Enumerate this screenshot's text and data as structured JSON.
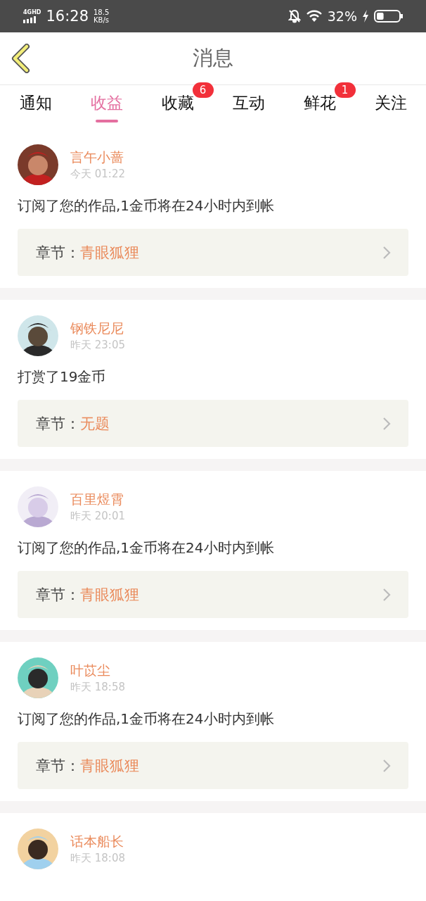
{
  "status_bar": {
    "network": "4GHD",
    "time": "16:28",
    "speed": "18.5",
    "speed_unit": "KB/s",
    "battery": "32%"
  },
  "header": {
    "title": "消息"
  },
  "tabs": [
    {
      "label": "通知",
      "selected": false
    },
    {
      "label": "收益",
      "selected": true
    },
    {
      "label": "收藏",
      "selected": false,
      "badge": "6"
    },
    {
      "label": "互动",
      "selected": false
    },
    {
      "label": "鲜花",
      "selected": false,
      "badge": "1"
    },
    {
      "label": "关注",
      "selected": false
    }
  ],
  "messages": [
    {
      "user": "言午小蔷",
      "time": "今天 01:22",
      "text": "订阅了您的作品,1金币将在24小时内到帐",
      "chapter_label": "章节：",
      "chapter": "青眼狐狸"
    },
    {
      "user": "钢铁尼尼",
      "time": "昨天 23:05",
      "text": "打赏了19金币",
      "chapter_label": "章节：",
      "chapter": "无题"
    },
    {
      "user": "百里煜霄",
      "time": "昨天 20:01",
      "text": "订阅了您的作品,1金币将在24小时内到帐",
      "chapter_label": "章节：",
      "chapter": "青眼狐狸"
    },
    {
      "user": "叶苡尘",
      "time": "昨天 18:58",
      "text": "订阅了您的作品,1金币将在24小时内到帐",
      "chapter_label": "章节：",
      "chapter": "青眼狐狸"
    },
    {
      "user": "话本船长",
      "time": "昨天 18:08"
    }
  ]
}
